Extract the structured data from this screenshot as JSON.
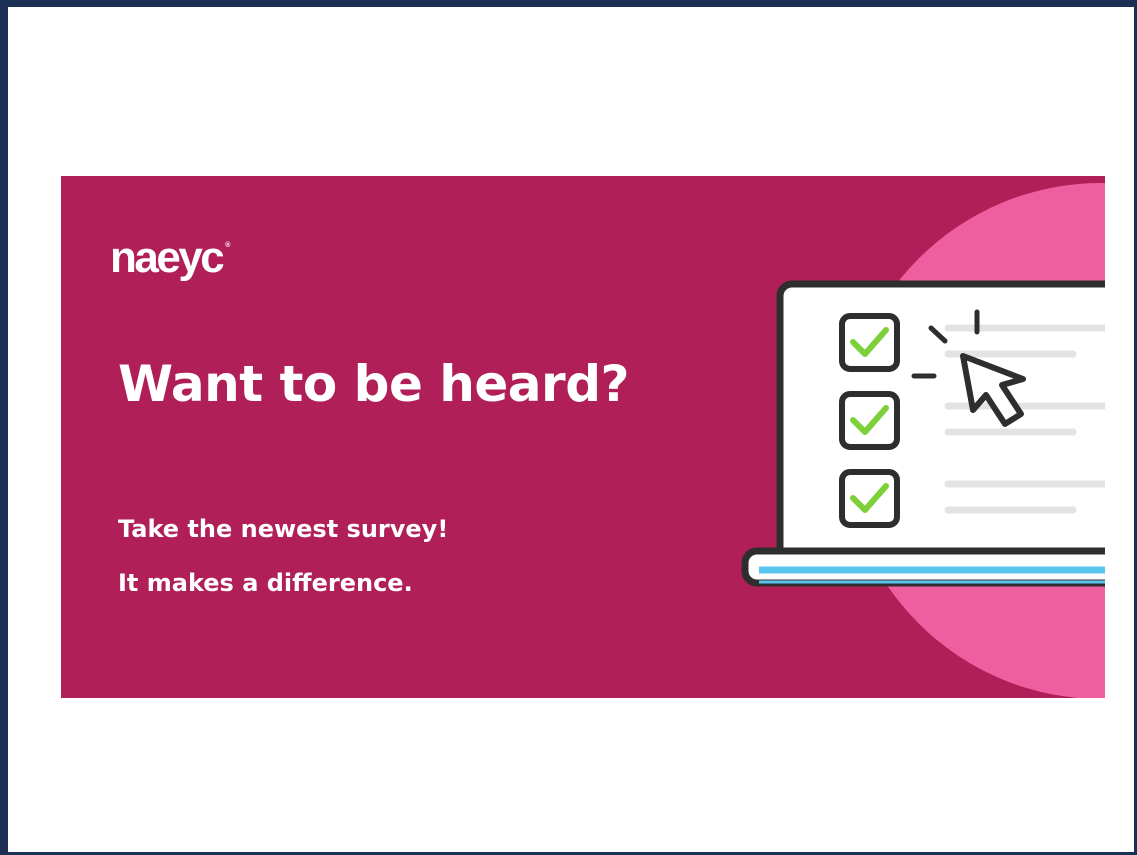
{
  "banner": {
    "logo_text": "naeyc",
    "logo_mark": "®",
    "headline": "Want to be heard?",
    "subline_1": "Take the newest survey!",
    "subline_2": "It makes a difference.",
    "illustration": {
      "laptop_icon": "laptop-survey-illustration",
      "checkboxes_checked": [
        true,
        true,
        true
      ],
      "cursor_icon": "mouse-pointer-click-icon"
    }
  },
  "colors": {
    "frame": "#1c2f55",
    "banner_bg": "#b01f57",
    "circle_accent": "#ee5fa0",
    "check_green": "#7ed03a",
    "outline": "#2e2e2e",
    "laptop_base_blue": "#59c5ee",
    "line_gray": "#e3e3e3"
  }
}
